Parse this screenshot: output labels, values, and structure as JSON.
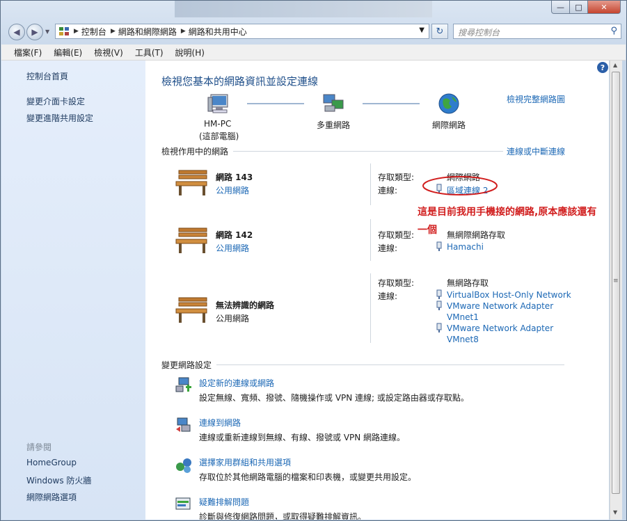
{
  "window": {
    "minimize": "—",
    "maximize": "□",
    "close": "✕"
  },
  "address": {
    "root_icon": "control-panel-icon",
    "segments": [
      "控制台",
      "網路和網際網路",
      "網路和共用中心"
    ]
  },
  "search": {
    "placeholder": "搜尋控制台"
  },
  "menu": [
    "檔案(F)",
    "編輯(E)",
    "檢視(V)",
    "工具(T)",
    "說明(H)"
  ],
  "sidebar": {
    "items": [
      "控制台首頁",
      "變更介面卡設定",
      "變更進階共用設定"
    ],
    "see_also_title": "請參閱",
    "see_also": [
      "HomeGroup",
      "Windows 防火牆",
      "網際網路選項"
    ]
  },
  "main": {
    "heading": "檢視您基本的網路資訊並設定連線",
    "full_map_link": "檢視完整網路圖",
    "map": {
      "pc_name": "HM-PC",
      "pc_sub": "(這部電腦)",
      "multi": "多重網路",
      "internet": "網際網路"
    },
    "active_title": "檢視作用中的網路",
    "connect_link": "連線或中斷連線",
    "access_label": "存取類型:",
    "conn_label": "連線:",
    "networks": [
      {
        "name": "網路  143",
        "type": "公用網路",
        "access": "網際網路",
        "connections": [
          "區域連線 2"
        ]
      },
      {
        "name": "網路  142",
        "type": "公用網路",
        "access": "無網際網路存取",
        "connections": [
          "Hamachi"
        ]
      },
      {
        "name": "無法辨識的網路",
        "type": "公用網路",
        "access": "無網路存取",
        "connections": [
          "VirtualBox Host-Only Network",
          "VMware Network Adapter",
          "VMnet1",
          "VMware Network Adapter",
          "VMnet8"
        ]
      }
    ],
    "annotation": [
      "這是目前我用手機接的網路,原本應該還有",
      "一個"
    ],
    "change_title": "變更網路設定",
    "tasks": [
      {
        "title": "設定新的連線或網路",
        "desc": "設定無線、寬頻、撥號、隨機操作或 VPN 連線; 或設定路由器或存取點。"
      },
      {
        "title": "連線到網路",
        "desc": "連線或重新連線到無線、有線、撥號或 VPN 網路連線。"
      },
      {
        "title": "選擇家用群組和共用選項",
        "desc": "存取位於其他網路電腦的檔案和印表機，或變更共用設定。"
      },
      {
        "title": "疑難排解問題",
        "desc": "診斷與修復網路問題，或取得疑難排解資訊。"
      }
    ]
  },
  "colors": {
    "link": "#1c68b5",
    "heading": "#1f4f8a",
    "annotation": "#d11e1e",
    "sidebar_bg": "#dfe9f8"
  }
}
